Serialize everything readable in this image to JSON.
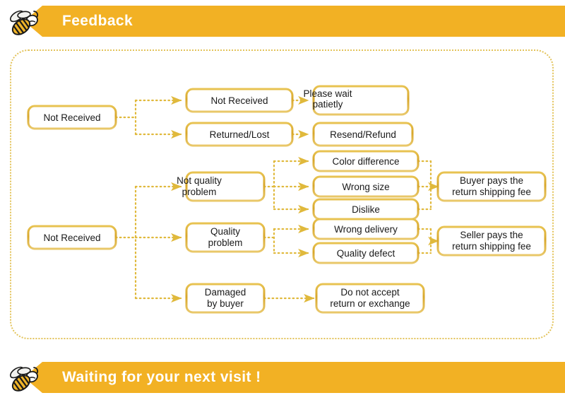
{
  "header": {
    "title": "Feedback",
    "bee_icon": "bee-icon",
    "watermark": ""
  },
  "footer": {
    "title": "Waiting for your next visit !",
    "bee_icon": "bee-icon"
  },
  "colors": {
    "banner": "#f2b124",
    "banner_text": "#ffffff",
    "box_border_outer": "#d8a72b",
    "box_border_inner": "#f3dc9a",
    "box_fill": "#ffffff",
    "connector": "#e0b93c",
    "dotted_frame": "#e3c35a",
    "text": "#1a1a1a"
  },
  "flow": {
    "nodes": {
      "root1": {
        "label": "Not Received",
        "lines": [
          "Not Received"
        ]
      },
      "root2": {
        "label": "Not Received",
        "lines": [
          "Not Received"
        ]
      },
      "n_not_received": {
        "label": "Not Received",
        "lines": [
          "Not Received"
        ]
      },
      "n_returned_lost": {
        "label": "Returned/Lost",
        "lines": [
          "Returned/Lost"
        ]
      },
      "n_please_wait": {
        "label": "Please wait patietly",
        "lines": [
          "Please wait",
          "patietly"
        ]
      },
      "n_resend_refund": {
        "label": "Resend/Refund",
        "lines": [
          "Resend/Refund"
        ]
      },
      "n_not_quality": {
        "label": "Not quality problem",
        "lines": [
          "Not quality",
          "problem"
        ]
      },
      "n_quality_problem": {
        "label": "Quality problem",
        "lines": [
          "Quality",
          "problem"
        ]
      },
      "n_damaged": {
        "label": "Damaged by buyer",
        "lines": [
          "Damaged",
          "by buyer"
        ]
      },
      "n_color_difference": {
        "label": "Color difference",
        "lines": [
          "Color difference"
        ]
      },
      "n_wrong_size": {
        "label": "Wrong size",
        "lines": [
          "Wrong size"
        ]
      },
      "n_dislike": {
        "label": "Dislike",
        "lines": [
          "Dislike"
        ]
      },
      "n_wrong_delivery": {
        "label": "Wrong delivery",
        "lines": [
          "Wrong delivery"
        ]
      },
      "n_quality_defect": {
        "label": "Quality defect",
        "lines": [
          "Quality defect"
        ]
      },
      "n_buyer_pays": {
        "label": "Buyer pays the return shipping fee",
        "lines": [
          "Buyer pays the",
          "return shipping fee"
        ]
      },
      "n_seller_pays": {
        "label": "Seller pays the return shipping fee",
        "lines": [
          "Seller pays the",
          "return shipping fee"
        ]
      },
      "n_do_not_accept": {
        "label": "Do not accept return or exchange",
        "lines": [
          "Do not accept",
          "return or exchange"
        ]
      }
    }
  }
}
